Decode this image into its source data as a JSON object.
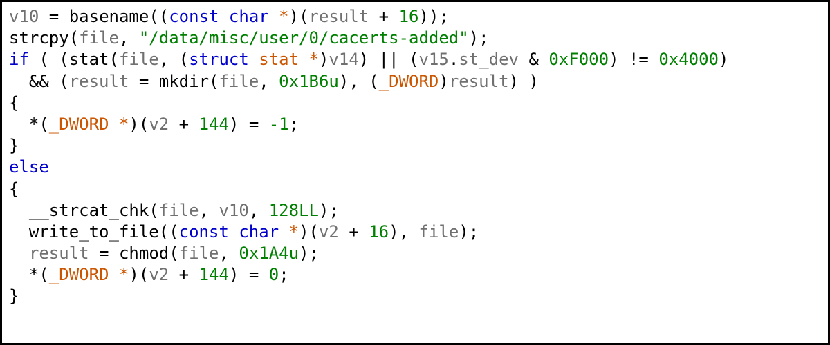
{
  "code": {
    "l1": {
      "v10": "v10",
      "eq": " = ",
      "basename": "basename",
      "lp": "((",
      "const": "const",
      "ch": " char ",
      "star": "*",
      "rp": ")(",
      "result": "result",
      "plus": " + ",
      "n16": "16",
      "end": "));"
    },
    "l2": {
      "strcpy": "strcpy",
      "lp": "(",
      "file": "file",
      "com": ", ",
      "str": "\"/data/misc/user/0/cacerts-added\"",
      "end": ");"
    },
    "l3": {
      "if": "if",
      "sp": " ( (",
      "stat": "stat",
      "lp": "(",
      "file": "file",
      "com": ", (",
      "struct": "struct",
      "sp2": " ",
      "statt": "stat",
      "star": " *",
      "rp": ")",
      "v14": "v14",
      "rp2": ") || (",
      "v15": "v15",
      "dot": ".",
      "stdev": "st_dev",
      "and": " & ",
      "hex1": "0xF000",
      "ne": ") != ",
      "hex2": "0x4000",
      "close": ")"
    },
    "l4": {
      "and": "  && (",
      "result": "result",
      "eq": " = ",
      "mkdir": "mkdir",
      "lp": "(",
      "file": "file",
      "com": ", ",
      "n": "0x1B6u",
      "rp": "), (",
      "dword": "_DWORD",
      "rp2": ")",
      "result2": "result",
      "end": ") )"
    },
    "l5": {
      "b": "{"
    },
    "l6": {
      "sp": "  *(",
      "dword": "_DWORD",
      "star": " *",
      "rp": ")(",
      "v2": "v2",
      "plus": " + ",
      "n144": "144",
      "rp2": ") = ",
      "neg1": "-1",
      "end": ";"
    },
    "l7": {
      "b": "}"
    },
    "l8": {
      "else": "else"
    },
    "l9": {
      "b": "{"
    },
    "l10": {
      "sp": "  ",
      "fn": "__strcat_chk",
      "lp": "(",
      "file": "file",
      "c": ", ",
      "v10": "v10",
      "c2": ", ",
      "n": "128LL",
      "end": ");"
    },
    "l11": {
      "sp": "  ",
      "fn": "write_to_file",
      "lp": "((",
      "const": "const",
      "ch": " char ",
      "star": "*",
      "rp": ")(",
      "v2": "v2",
      "plus": " + ",
      "n16": "16",
      "rp2": "), ",
      "file": "file",
      "end": ");"
    },
    "l12": {
      "sp": "  ",
      "result": "result",
      "eq": " = ",
      "chmod": "chmod",
      "lp": "(",
      "file": "file",
      "c": ", ",
      "n": "0x1A4u",
      "end": ");"
    },
    "l13": {
      "sp": "  *(",
      "dword": "_DWORD",
      "star": " *",
      "rp": ")(",
      "v2": "v2",
      "plus": " + ",
      "n144": "144",
      "rp2": ") = ",
      "zero": "0",
      "end": ";"
    },
    "l14": {
      "b": "}"
    }
  }
}
